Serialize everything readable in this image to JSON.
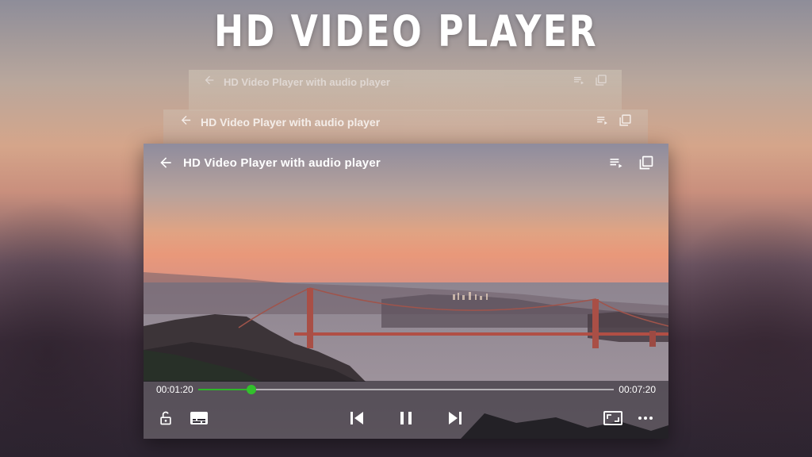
{
  "banner": {
    "title": "HD VIDEO PLAYER"
  },
  "ghost_screens": [
    {
      "title": "HD Video Player  with audio player"
    },
    {
      "title": "HD Video Player  with audio player"
    }
  ],
  "player": {
    "title": "HD Video Player  with audio player",
    "current_time": "00:01:20",
    "total_time": "00:07:20",
    "progress": 0.128,
    "accent_color": "#2fb52a"
  },
  "icons": {
    "back": "back-arrow-icon",
    "playlist": "playlist-play-icon",
    "popup": "popup-window-icon",
    "lock": "lock-open-icon",
    "subtitles": "subtitles-icon",
    "previous": "skip-previous-icon",
    "pause": "pause-icon",
    "next": "skip-next-icon",
    "aspect": "aspect-ratio-icon",
    "more": "more-horizontal-icon"
  }
}
